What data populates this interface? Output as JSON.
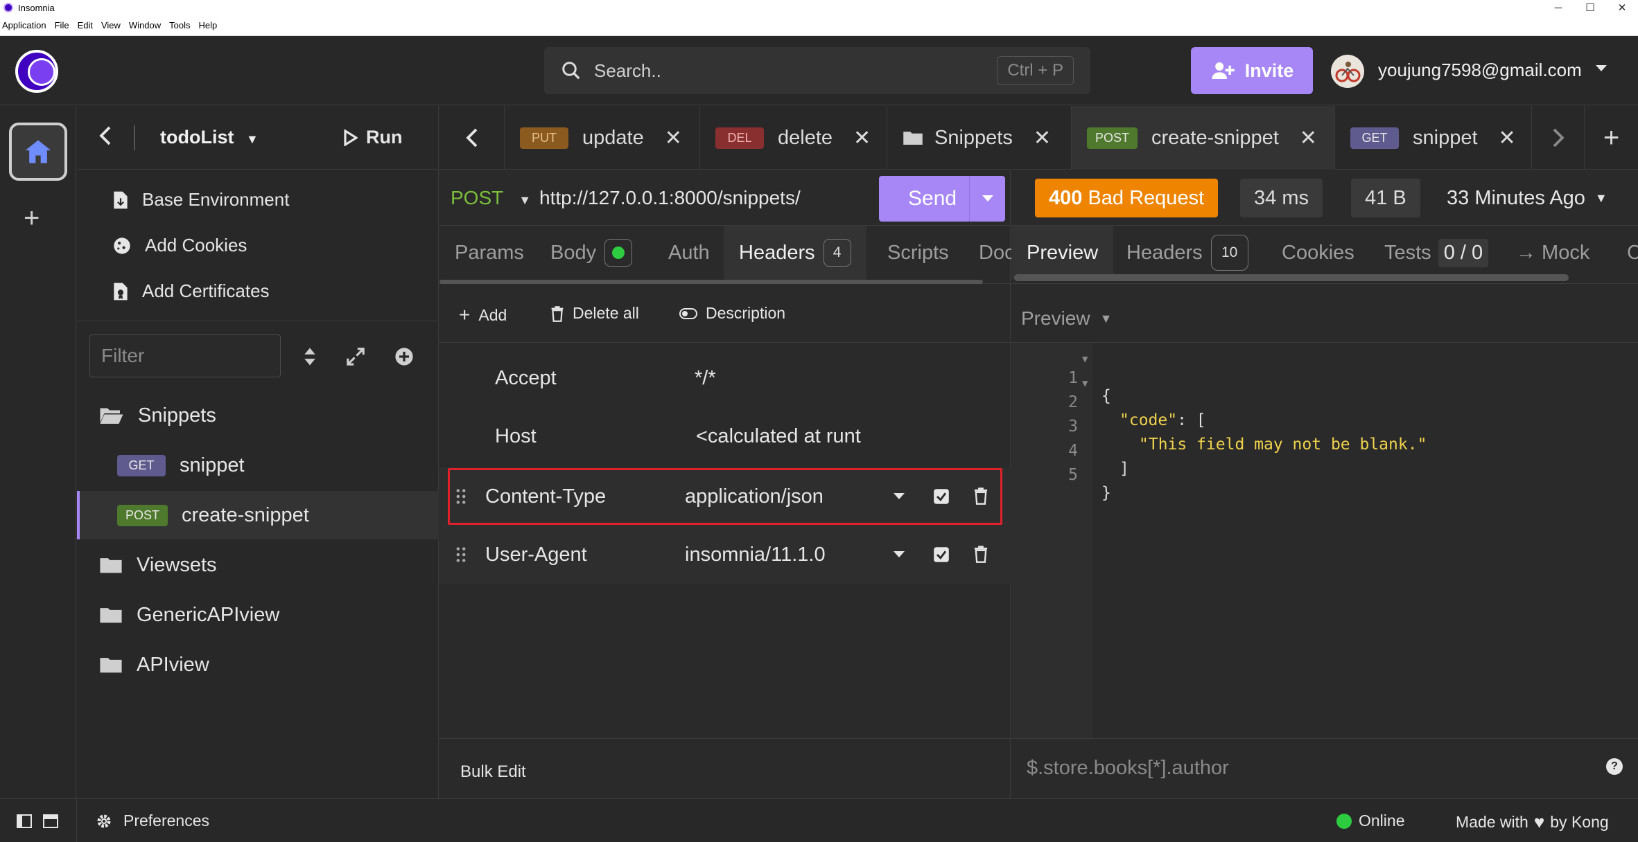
{
  "window": {
    "title": "Insomnia"
  },
  "menubar": [
    "Application",
    "File",
    "Edit",
    "View",
    "Window",
    "Tools",
    "Help"
  ],
  "header": {
    "search_placeholder": "Search..",
    "search_shortcut": "Ctrl + P",
    "invite_label": "Invite",
    "user_email": "youjung7598@gmail.com"
  },
  "sidebar": {
    "project_name": "todoList",
    "run_label": "Run",
    "links": [
      "Base Environment",
      "Add Cookies",
      "Add Certificates"
    ],
    "filter_placeholder": "Filter",
    "tree": [
      {
        "type": "folder",
        "label": "Snippets",
        "open": true
      },
      {
        "type": "request",
        "method": "GET",
        "label": "snippet"
      },
      {
        "type": "request",
        "method": "POST",
        "label": "create-snippet",
        "active": true
      },
      {
        "type": "folder",
        "label": "Viewsets"
      },
      {
        "type": "folder",
        "label": "GenericAPIview"
      },
      {
        "type": "folder",
        "label": "APIview"
      }
    ]
  },
  "tabs": [
    {
      "method": "PUT",
      "label": "update"
    },
    {
      "method": "DEL",
      "label": "delete"
    },
    {
      "method": "",
      "label": "Snippets"
    },
    {
      "method": "POST",
      "label": "create-snippet",
      "active": true
    },
    {
      "method": "GET",
      "label": "snippet"
    }
  ],
  "request": {
    "method": "POST",
    "url": "http://127.0.0.1:8000/snippets/",
    "send_label": "Send",
    "tabs": {
      "params": "Params",
      "body": "Body",
      "auth": "Auth",
      "headers": "Headers",
      "headers_count": "4",
      "scripts": "Scripts",
      "docs": "Doc"
    },
    "toolbar": {
      "add": "Add",
      "delete_all": "Delete all",
      "description": "Description"
    },
    "headers": [
      {
        "name": "Accept",
        "value": "*/*"
      },
      {
        "name": "Host",
        "value": "<calculated at runt"
      },
      {
        "name": "Content-Type",
        "value": "application/json"
      },
      {
        "name": "User-Agent",
        "value": "insomnia/11.1.0"
      }
    ],
    "bulk_edit": "Bulk Edit"
  },
  "response": {
    "status_code": "400",
    "status_text": "Bad Request",
    "time": "34 ms",
    "size": "41 B",
    "ago": "33 Minutes Ago",
    "tabs": {
      "preview": "Preview",
      "headers": "Headers",
      "headers_count": "10",
      "cookies": "Cookies",
      "tests": "Tests",
      "tests_count": "0 / 0",
      "mock": "→ Mock",
      "more": "C"
    },
    "preview_mode": "Preview",
    "lines": [
      "1",
      "2",
      "3",
      "4",
      "5"
    ],
    "body": {
      "l1": "{",
      "key": "\"code\"",
      "l2_rest": ": [",
      "msg": "\"This field may not be blank.\"",
      "l4": "]",
      "l5": "}"
    },
    "filter_placeholder": "$.store.books[*].author",
    "help": "?"
  },
  "footer": {
    "preferences": "Preferences",
    "online": "Online",
    "made_with_prefix": "Made with",
    "made_with_suffix": "by Kong"
  },
  "colors": {
    "accent": "#a687f5",
    "post": "#7bbf3a",
    "status_error": "#ee8400",
    "highlight": "#e0202a"
  }
}
